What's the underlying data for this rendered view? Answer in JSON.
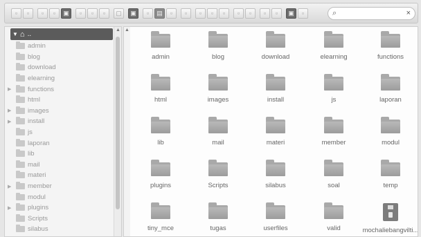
{
  "toolbar": {
    "groups": [
      [
        "back-icon",
        "forward-icon"
      ],
      [
        "reload-icon",
        "open-icon",
        "save-icon"
      ],
      [
        "copy-icon",
        "cut-icon",
        "paste-icon"
      ],
      [
        "rename-icon"
      ],
      [
        "preview-icon"
      ],
      [
        "new-folder-icon",
        "new-file-icon",
        "upload-icon"
      ],
      [
        "duplicate-icon"
      ],
      [
        "extract-icon",
        "archive-icon",
        "resize-icon"
      ],
      [
        "view-icons-icon",
        "view-list-icon"
      ],
      [
        "sort-icon",
        "edit-icon"
      ],
      [
        "info-icon",
        "help-icon"
      ]
    ],
    "search": {
      "icon": "search-icon",
      "placeholder": "",
      "value": "",
      "clear_icon": "close-icon"
    }
  },
  "sidebar": {
    "root_label": "..",
    "items": [
      {
        "label": "admin",
        "expandable": false
      },
      {
        "label": "blog",
        "expandable": false
      },
      {
        "label": "download",
        "expandable": false
      },
      {
        "label": "elearning",
        "expandable": false
      },
      {
        "label": "functions",
        "expandable": true
      },
      {
        "label": "html",
        "expandable": false
      },
      {
        "label": "images",
        "expandable": true
      },
      {
        "label": "install",
        "expandable": true
      },
      {
        "label": "js",
        "expandable": false
      },
      {
        "label": "laporan",
        "expandable": false
      },
      {
        "label": "lib",
        "expandable": false
      },
      {
        "label": "mail",
        "expandable": false
      },
      {
        "label": "materi",
        "expandable": false
      },
      {
        "label": "member",
        "expandable": true
      },
      {
        "label": "modul",
        "expandable": false
      },
      {
        "label": "plugins",
        "expandable": true
      },
      {
        "label": "Scripts",
        "expandable": false
      },
      {
        "label": "silabus",
        "expandable": false
      }
    ]
  },
  "main": {
    "items": [
      {
        "label": "admin",
        "type": "folder"
      },
      {
        "label": "blog",
        "type": "folder"
      },
      {
        "label": "download",
        "type": "folder"
      },
      {
        "label": "elearning",
        "type": "folder"
      },
      {
        "label": "functions",
        "type": "folder"
      },
      {
        "label": "html",
        "type": "folder"
      },
      {
        "label": "images",
        "type": "folder"
      },
      {
        "label": "install",
        "type": "folder"
      },
      {
        "label": "js",
        "type": "folder"
      },
      {
        "label": "laporan",
        "type": "folder"
      },
      {
        "label": "lib",
        "type": "folder"
      },
      {
        "label": "mail",
        "type": "folder"
      },
      {
        "label": "materi",
        "type": "folder"
      },
      {
        "label": "member",
        "type": "folder"
      },
      {
        "label": "modul",
        "type": "folder"
      },
      {
        "label": "plugins",
        "type": "folder"
      },
      {
        "label": "Scripts",
        "type": "folder"
      },
      {
        "label": "silabus",
        "type": "folder"
      },
      {
        "label": "soal",
        "type": "folder"
      },
      {
        "label": "temp",
        "type": "folder"
      },
      {
        "label": "tiny_mce",
        "type": "folder"
      },
      {
        "label": "tugas",
        "type": "folder"
      },
      {
        "label": "userfiles",
        "type": "folder"
      },
      {
        "label": "valid",
        "type": "folder"
      },
      {
        "label": "mochaliebangvilti...",
        "type": "archive"
      }
    ]
  },
  "colors": {
    "selected_bg": "#5b5b5b",
    "folder": "#a9a9a9",
    "text": "#666666"
  }
}
